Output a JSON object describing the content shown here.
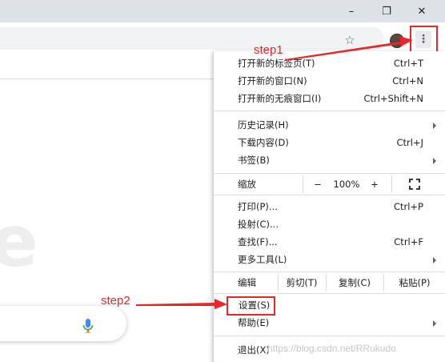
{
  "window_controls": {
    "minimize": "–",
    "restore": "❐",
    "close": "✕"
  },
  "menu": {
    "new_tab": {
      "label": "打开新的标签页(T)",
      "shortcut": "Ctrl+T"
    },
    "new_window": {
      "label": "打开新的窗口(N)",
      "shortcut": "Ctrl+N"
    },
    "new_incognito": {
      "label": "打开新的无痕窗口(I)",
      "shortcut": "Ctrl+Shift+N"
    },
    "history": {
      "label": "历史记录(H)"
    },
    "downloads": {
      "label": "下载内容(D)",
      "shortcut": "Ctrl+J"
    },
    "bookmarks": {
      "label": "书签(B)"
    },
    "zoom": {
      "label": "缩放",
      "minus": "−",
      "value": "100%",
      "plus": "+"
    },
    "print": {
      "label": "打印(P)...",
      "shortcut": "Ctrl+P"
    },
    "cast": {
      "label": "投射(C)..."
    },
    "find": {
      "label": "查找(F)...",
      "shortcut": "Ctrl+F"
    },
    "more_tools": {
      "label": "更多工具(L)"
    },
    "edit": {
      "label": "编辑",
      "cut": "剪切(T)",
      "copy": "复制(C)",
      "paste": "粘贴(P)"
    },
    "settings": {
      "label": "设置(S)"
    },
    "help": {
      "label": "帮助(E)"
    },
    "exit": {
      "label": "退出(X)"
    }
  },
  "background_letter": "e",
  "annotations": {
    "step1": "step1",
    "step2": "step2"
  },
  "annotation_color": "#e8262b",
  "watermark": "https://blog.csdn.net/RRukudo",
  "icons": [
    "star-icon",
    "avatar",
    "more-vert-icon",
    "mic-icon",
    "fullscreen-icon",
    "submenu-arrow-icon"
  ]
}
